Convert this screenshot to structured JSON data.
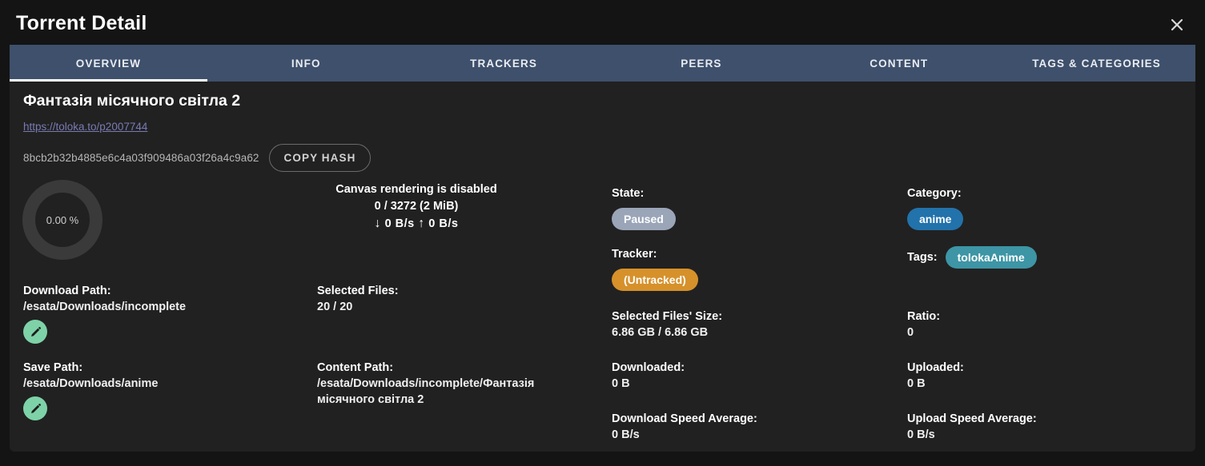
{
  "window": {
    "title": "Torrent Detail",
    "close_icon": "close-icon"
  },
  "tabs": [
    {
      "label": "OVERVIEW",
      "active": true
    },
    {
      "label": "INFO",
      "active": false
    },
    {
      "label": "TRACKERS",
      "active": false
    },
    {
      "label": "PEERS",
      "active": false
    },
    {
      "label": "CONTENT",
      "active": false
    },
    {
      "label": "TAGS & CATEGORIES",
      "active": false
    }
  ],
  "overview": {
    "torrent_name": "Фантазія місячного світла 2",
    "url": "https://toloka.to/p2007744",
    "hash": "8bcb2b32b4885e6c4a03f909486a03f26a4c9a62",
    "copy_hash_label": "COPY HASH",
    "progress_percent": "0.00 %",
    "progress_value": 0,
    "canvas_notice": "Canvas rendering is disabled",
    "pieces": "0 / 3272 (2 MiB)",
    "download_arrow": "↓",
    "download_speed": "0 B/s",
    "upload_arrow": "↑",
    "upload_speed": "0 B/s",
    "download_path": {
      "label": "Download Path:",
      "value": "/esata/Downloads/incomplete",
      "edit_icon": "pencil-icon"
    },
    "save_path": {
      "label": "Save Path:",
      "value": "/esata/Downloads/anime",
      "edit_icon": "pencil-icon"
    },
    "selected_files": {
      "label": "Selected Files:",
      "value": "20 / 20"
    },
    "content_path": {
      "label": "Content Path:",
      "value": "/esata/Downloads/incomplete/Фантазія місячного світла 2"
    },
    "state": {
      "label": "State:",
      "value": "Paused",
      "color": "#9aa5b8"
    },
    "tracker": {
      "label": "Tracker:",
      "value": "(Untracked)",
      "color": "#d6912b"
    },
    "selected_files_size": {
      "label": "Selected Files' Size:",
      "value": "6.86 GB / 6.86 GB"
    },
    "downloaded": {
      "label": "Downloaded:",
      "value": "0 B"
    },
    "download_speed_average": {
      "label": "Download Speed Average:",
      "value": "0 B/s"
    },
    "category": {
      "label": "Category:",
      "value": "anime",
      "color": "#2272ab"
    },
    "tags": {
      "label": "Tags:",
      "values": [
        "tolokaAnime"
      ],
      "color": "#3d95a5"
    },
    "ratio": {
      "label": "Ratio:",
      "value": "0"
    },
    "uploaded": {
      "label": "Uploaded:",
      "value": "0 B"
    },
    "upload_speed_average": {
      "label": "Upload Speed Average:",
      "value": "0 B/s"
    }
  },
  "colors": {
    "background": "#141414",
    "panel": "#212121",
    "tabbar": "#3e506b",
    "accent": "#ffffff",
    "link": "#7a7ab4",
    "edit_button": "#7ed2a8"
  }
}
